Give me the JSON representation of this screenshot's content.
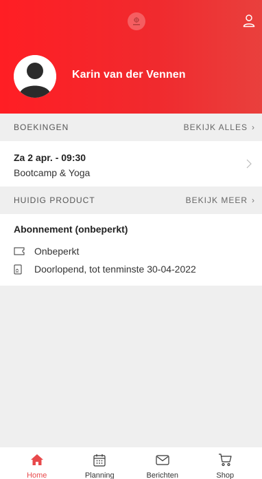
{
  "header": {
    "user_name": "Karin van der Vennen",
    "brand_color": "#ff1e24"
  },
  "bookings_section": {
    "title": "BOEKINGEN",
    "action": "BEKIJK ALLES"
  },
  "booking": {
    "date": "Za 2 apr. - 09:30",
    "activity": "Bootcamp & Yoga"
  },
  "product_section": {
    "title": "HUIDIG PRODUCT",
    "action": "BEKIJK MEER"
  },
  "product": {
    "title": "Abonnement (onbeperkt)",
    "lines": [
      {
        "icon": "ticket-icon",
        "text": "Onbeperkt"
      },
      {
        "icon": "document-icon",
        "text": "Doorlopend, tot tenminste 30-04-2022"
      }
    ]
  },
  "tabs": [
    {
      "label": "Home",
      "icon": "home-icon",
      "active": true
    },
    {
      "label": "Planning",
      "icon": "calendar-icon",
      "active": false
    },
    {
      "label": "Berichten",
      "icon": "mail-icon",
      "active": false
    },
    {
      "label": "Shop",
      "icon": "cart-icon",
      "active": false
    }
  ],
  "colors": {
    "active_tab": "#e8494b",
    "section_bg": "#efefef"
  }
}
